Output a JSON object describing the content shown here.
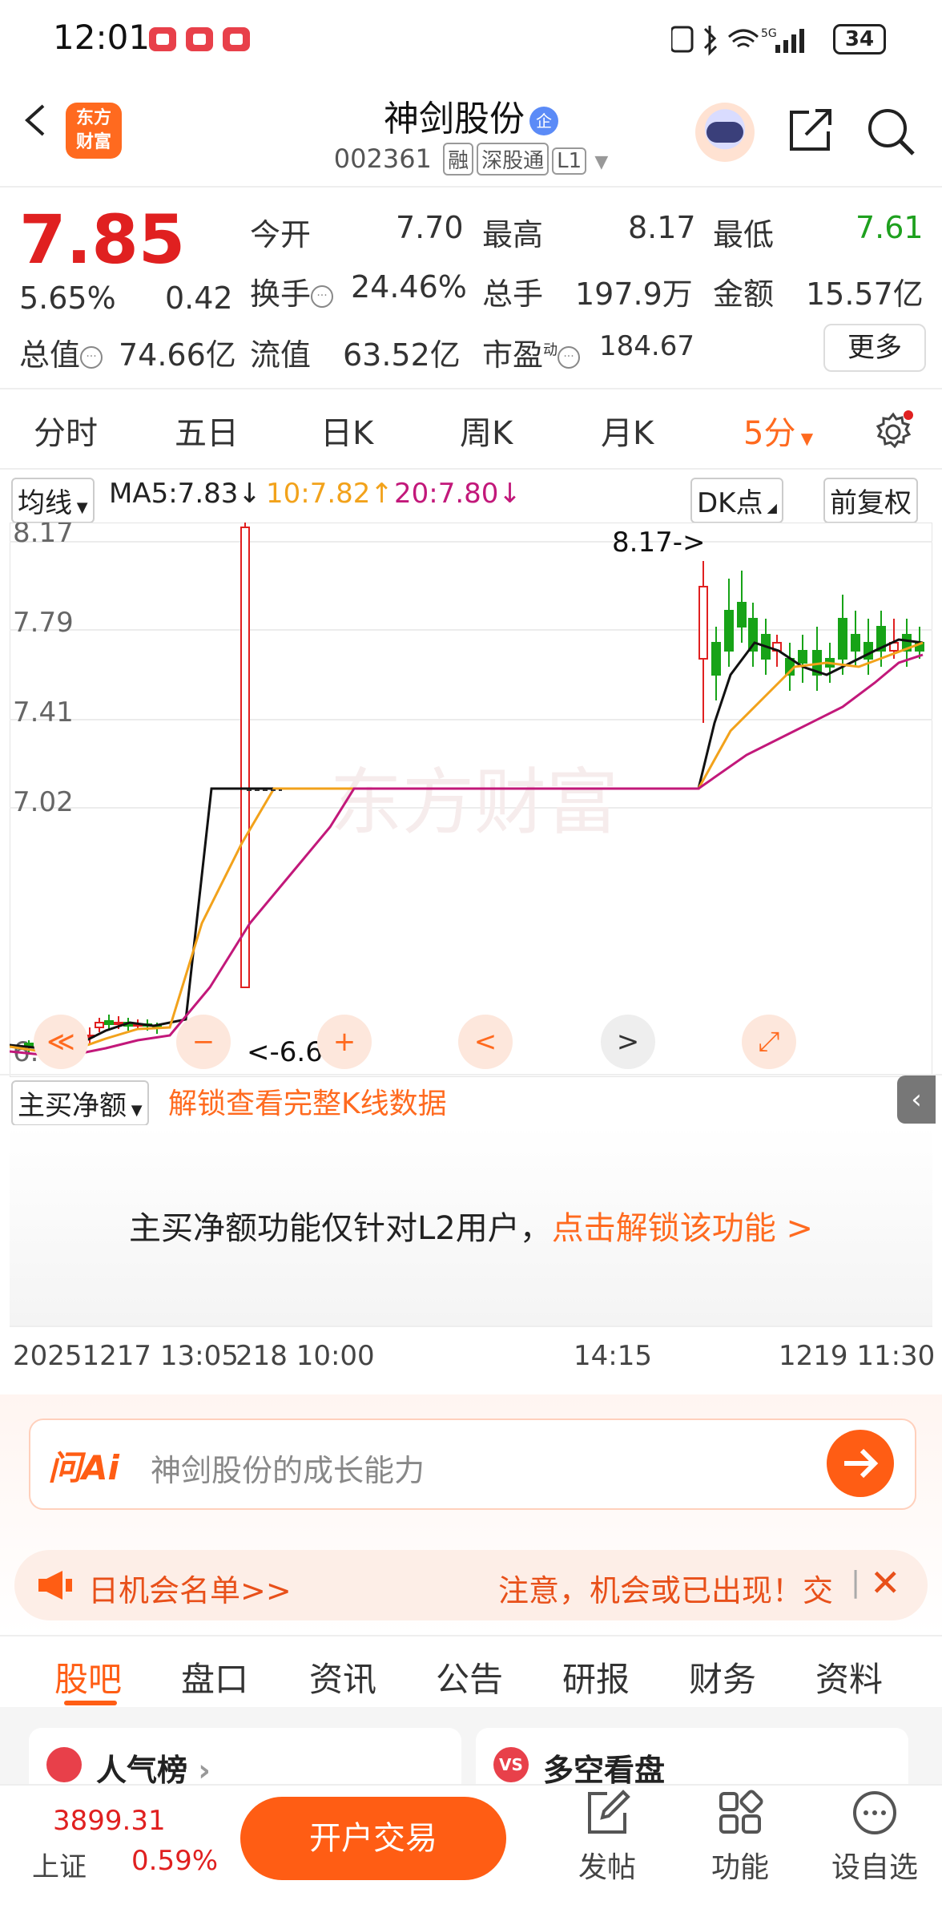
{
  "status": {
    "time": "12:01",
    "battery": "34",
    "net": "5G"
  },
  "header": {
    "logo": "东方\n财富",
    "title": "神剑股份",
    "ent_badge": "企",
    "code": "002361",
    "tags": [
      "融",
      "深股通",
      "L1"
    ]
  },
  "quote": {
    "price": "7.85",
    "change_pct": "5.65%",
    "change": "0.42",
    "open_label": "今开",
    "open": "7.70",
    "high_label": "最高",
    "high": "8.17",
    "low_label": "最低",
    "low": "7.61",
    "turnover_label": "换手",
    "turnover": "24.46%",
    "volume_label": "总手",
    "volume": "197.9万",
    "amount_label": "金额",
    "amount": "15.57亿",
    "mktcap_label": "总值",
    "mktcap": "74.66亿",
    "float_label": "流值",
    "float": "63.52亿",
    "pe_label": "市盈",
    "pe_sup": "动",
    "pe": "184.67",
    "more": "更多"
  },
  "tabs": [
    "分时",
    "五日",
    "日K",
    "周K",
    "月K",
    "5分"
  ],
  "ma": {
    "type": "均线",
    "ma5": "MA5:7.83↓",
    "ma10": "10:7.82↑",
    "ma20": "20:7.80↓",
    "dk": "DK点",
    "adjust": "前复权"
  },
  "chart_data": {
    "type": "candlestick",
    "y_ticks": [
      "8.17",
      "7.79",
      "7.41",
      "7.02",
      "6.6"
    ],
    "ylim": [
      6.55,
      8.2
    ],
    "high_label": "8.17->",
    "low_label": "<-6.64",
    "watermark": "东方财富",
    "series": [
      {
        "name": "MA5",
        "color": "#111111"
      },
      {
        "name": "10",
        "color": "#f2a21b"
      },
      {
        "name": "20",
        "color": "#c2187a"
      }
    ],
    "colors": {
      "up": "#e02020",
      "down": "#17a317"
    }
  },
  "controls": [
    "≪",
    "−",
    "+",
    "<",
    ">",
    "⤢"
  ],
  "netbuy": {
    "select": "主买净额",
    "unlock": "解锁查看完整K线数据",
    "msg": "主买净额功能仅针对L2用户，",
    "link": "点击解锁该功能 >"
  },
  "timeline": {
    "t1": "20251217 13:05",
    "t2": "218 10:00",
    "t3": "14:15",
    "t4": "1219 11:30"
  },
  "ai": {
    "brand": "问Ai",
    "placeholder": "神剑股份的成长能力"
  },
  "announce": {
    "left": "日机会名单>>",
    "right": "注意，机会或已出现！交"
  },
  "bottom_tabs": [
    "股吧",
    "盘口",
    "资讯",
    "公告",
    "研报",
    "财务",
    "资料"
  ],
  "cards": {
    "left": "人气榜",
    "right": "多空看盘"
  },
  "index": {
    "value": "3899.31",
    "name": "上证",
    "pct": "0.59%"
  },
  "bottom": {
    "trade": "开户交易",
    "post": "发帖",
    "func": "功能",
    "watch": "设自选"
  },
  "accent": "#ff5d14"
}
